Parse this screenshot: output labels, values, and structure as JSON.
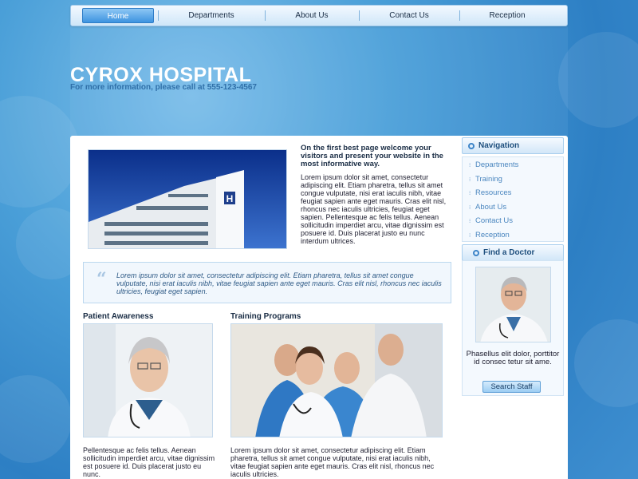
{
  "nav": {
    "items": [
      "Home",
      "Departments",
      "About Us",
      "Contact Us",
      "Reception"
    ]
  },
  "header": {
    "title": "CYROX HOSPITAL",
    "subtitle": "For more information, please call at 555-123-4567"
  },
  "main": {
    "intro_title": "On the first best page  welcome your visitors and present your website in the most informative way.",
    "intro_body": "Lorem ipsum dolor sit amet, consectetur adipiscing elit. Etiam pharetra, tellus sit amet congue vulputate, nisi erat iaculis nibh, vitae feugiat sapien ante eget mauris. Cras elit nisl, rhoncus nec iaculis ultricies, feugiat eget sapien. Pellentesque ac felis tellus. Aenean sollicitudin imperdiet arcu, vitae dignissim est posuere id. Duis placerat justo eu nunc interdum ultrices.",
    "quote": "Lorem ipsum dolor sit amet, consectetur adipiscing elit. Etiam pharetra, tellus sit amet congue vulputate, nisi erat iaculis nibh, vitae feugiat sapien ante eget mauris. Cras elit nisl, rhoncus nec iaculis ultricies, feugiat eget sapien.",
    "col1": {
      "title": "Patient Awareness",
      "text": "Pellentesque ac felis tellus. Aenean sollicitudin imperdiet arcu, vitae dignissim est posuere id. Duis placerat justo eu nunc."
    },
    "col2": {
      "title": "Training Programs",
      "text": "Lorem ipsum dolor sit amet, consectetur adipiscing elit. Etiam pharetra, tellus sit amet congue vulputate, nisi erat iaculis nibh, vitae feugiat sapien ante eget mauris. Cras elit nisl, rhoncus nec iaculis ultricies."
    }
  },
  "sidebar": {
    "nav_title": "Navigation",
    "nav_items": [
      "Departments",
      "Training",
      "Resources",
      "About Us",
      "Contact Us",
      "Reception"
    ],
    "doctor_title": "Find a Doctor",
    "doctor_text": "Phasellus elit dolor, porttitor id consec tetur sit ame.",
    "search_label": "Search Staff"
  },
  "colors": {
    "accent": "#3d93e0",
    "title_text": "#1a2d45",
    "link": "#4a86bf"
  }
}
